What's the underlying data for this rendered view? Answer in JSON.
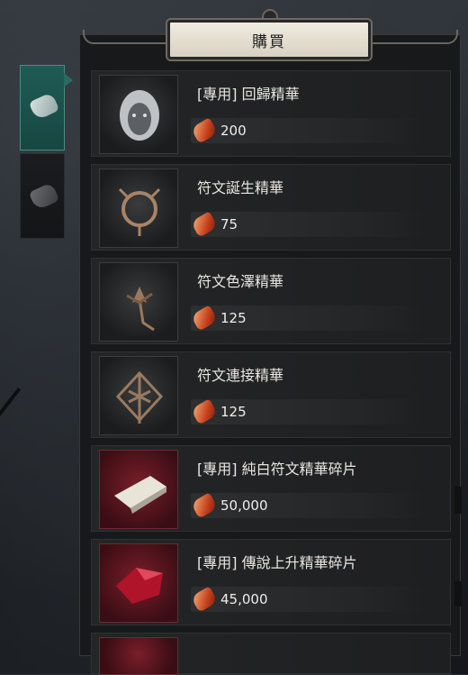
{
  "title": "購買",
  "tabs": [
    {
      "name": "essence-tab",
      "active": true
    },
    {
      "name": "material-tab",
      "active": false
    }
  ],
  "items": [
    {
      "name": "[專用] 回歸精華",
      "price": "200",
      "rarity": "normal",
      "icon": "hooded-face-icon"
    },
    {
      "name": "符文誕生精華",
      "price": "75",
      "rarity": "normal",
      "icon": "thorn-ring-icon"
    },
    {
      "name": "符文色澤精華",
      "price": "125",
      "rarity": "normal",
      "icon": "lily-flower-icon"
    },
    {
      "name": "符文連接精華",
      "price": "125",
      "rarity": "normal",
      "icon": "rune-diamond-icon"
    },
    {
      "name": "[專用] 純白符文精華碎片",
      "price": "50,000",
      "rarity": "legendary",
      "icon": "white-shard-icon"
    },
    {
      "name": "[專用] 傳說上升精華碎片",
      "price": "45,000",
      "rarity": "legendary",
      "icon": "red-crystal-icon"
    }
  ],
  "currency_icon": "red-gem-currency-icon"
}
